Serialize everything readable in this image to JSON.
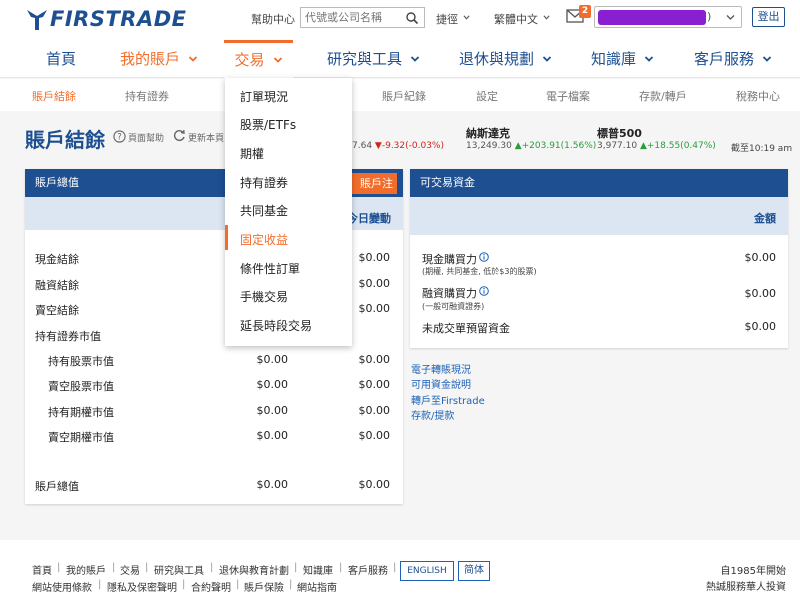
{
  "header": {
    "logo_text": "FIRSTRADE",
    "help_center": "幫助中心",
    "search_placeholder": "代號或公司名稱",
    "quick_links": "捷徑",
    "language": "繁體中文",
    "mail_badge": "2",
    "account_suffix": ")",
    "logout": "登出"
  },
  "main_nav": {
    "home": "首頁",
    "my_account": "我的賬戶",
    "trade": "交易",
    "research": "研究與工具",
    "retirement": "退休與規劃",
    "knowledge": "知識庫",
    "service": "客戶服務"
  },
  "sub_nav": {
    "balances": "賬戶結餘",
    "positions": "持有證券",
    "history": "賬戶紀錄",
    "settings": "設定",
    "documents": "電子檔案",
    "transfers": "存款/轉戶",
    "tax": "稅務中心"
  },
  "page": {
    "title": "賬戶結餘",
    "page_help": "頁面幫助",
    "refresh": "更新本頁"
  },
  "indices": {
    "first_partial": {
      "value": "7.64",
      "change": "▼-9.32(-0.03%)"
    },
    "nasdaq": {
      "name": "納斯達克",
      "value": "13,249.30",
      "change": "▲+203.91(1.56%)"
    },
    "sp500": {
      "name": "標普500",
      "value": "3,977.10",
      "change": "▲+18.55(0.47%)"
    },
    "as_of": "截至10:19 am"
  },
  "left_panel": {
    "header": "賬戶總值",
    "notice_button": "賬戶注資",
    "col_change": "今日變動",
    "rows": [
      {
        "label": "現金結餘",
        "value": "",
        "change": "$0.00"
      },
      {
        "label": "融資結餘",
        "value": "",
        "change": "$0.00"
      },
      {
        "label": "賣空結餘",
        "value": "",
        "change": "$0.00"
      },
      {
        "label": "持有證券市值",
        "value": "",
        "change": ""
      },
      {
        "label": "持有股票市值",
        "value": "$0.00",
        "change": "$0.00"
      },
      {
        "label": "賣空股票市值",
        "value": "$0.00",
        "change": "$0.00"
      },
      {
        "label": "持有期權市值",
        "value": "$0.00",
        "change": "$0.00"
      },
      {
        "label": "賣空期權市值",
        "value": "$0.00",
        "change": "$0.00"
      },
      {
        "label": "賬戶總值",
        "value": "$0.00",
        "change": "$0.00"
      }
    ]
  },
  "right_panel": {
    "header": "可交易資金",
    "col_amount": "金額",
    "rows": [
      {
        "label": "現金購買力",
        "note": "(期權, 共同基金, 低於$3的股票)",
        "value": "$0.00"
      },
      {
        "label": "融資購買力",
        "note": "(一般可融資證券)",
        "value": "$0.00"
      },
      {
        "label": "未成交單預留資金",
        "note": "",
        "value": "$0.00"
      }
    ]
  },
  "side_links": [
    "電子轉賬現況",
    "可用資金說明",
    "轉戶至Firstrade",
    "存款/提款"
  ],
  "trade_dropdown": [
    "訂單現況",
    "股票/ETFs",
    "期權",
    "持有證券",
    "共同基金",
    "固定收益",
    "條件性訂單",
    "手機交易",
    "延長時段交易"
  ],
  "footer": {
    "links_row1": [
      "首頁",
      "我的賬戶",
      "交易",
      "研究與工具",
      "退休與教育計劃",
      "知識庫",
      "客戶服務"
    ],
    "links_row2": [
      "網站使用條款",
      "隱私及保密聲明",
      "合約聲明",
      "賬戶保險",
      "網站指南"
    ],
    "lang_en": "ENGLISH",
    "lang_sc": "简体",
    "since": "自1985年開始",
    "slogan": "熱誠服務華人投資"
  },
  "colors": {
    "brand": "#1d4f91",
    "accent": "#f26d2c",
    "up": "#2a9d3a",
    "down": "#d0241b"
  }
}
